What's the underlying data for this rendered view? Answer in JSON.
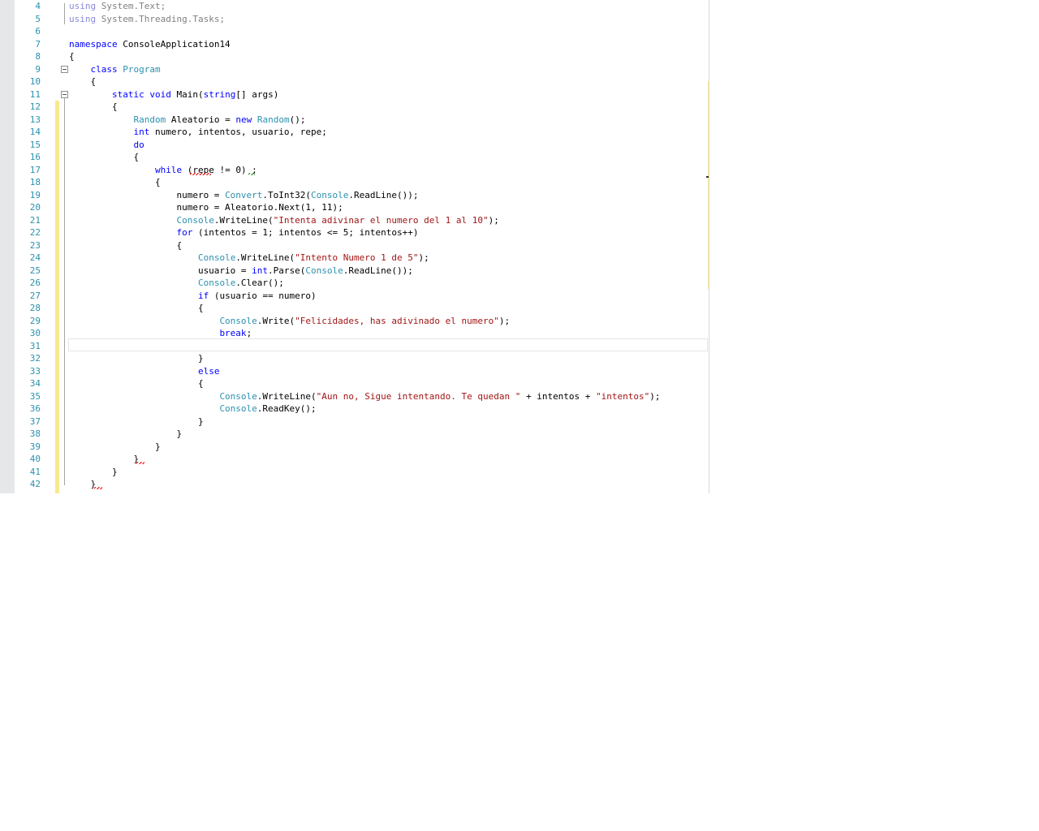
{
  "editor": {
    "lines": [
      {
        "n": "4",
        "segments": [
          {
            "t": "using",
            "c": "dim-kw"
          },
          {
            "t": " System.Text;",
            "c": "dim"
          }
        ]
      },
      {
        "n": "5",
        "segments": [
          {
            "t": "using",
            "c": "dim-kw"
          },
          {
            "t": " System.Threading.Tasks;",
            "c": "dim"
          }
        ]
      },
      {
        "n": "6",
        "segments": []
      },
      {
        "n": "7",
        "segments": [
          {
            "t": "namespace",
            "c": "kw"
          },
          {
            "t": " ConsoleApplication14",
            "c": ""
          }
        ]
      },
      {
        "n": "8",
        "segments": [
          {
            "t": "{",
            "c": ""
          }
        ]
      },
      {
        "n": "9",
        "segments": [
          {
            "t": "    ",
            "c": ""
          },
          {
            "t": "class",
            "c": "kw"
          },
          {
            "t": " ",
            "c": ""
          },
          {
            "t": "Program",
            "c": "ty"
          }
        ]
      },
      {
        "n": "10",
        "segments": [
          {
            "t": "    {",
            "c": ""
          }
        ]
      },
      {
        "n": "11",
        "segments": [
          {
            "t": "        ",
            "c": ""
          },
          {
            "t": "static",
            "c": "kw"
          },
          {
            "t": " ",
            "c": ""
          },
          {
            "t": "void",
            "c": "kw"
          },
          {
            "t": " Main(",
            "c": ""
          },
          {
            "t": "string",
            "c": "kw"
          },
          {
            "t": "[] args)",
            "c": ""
          }
        ]
      },
      {
        "n": "12",
        "segments": [
          {
            "t": "        {",
            "c": ""
          }
        ]
      },
      {
        "n": "13",
        "segments": [
          {
            "t": "            ",
            "c": ""
          },
          {
            "t": "Random",
            "c": "ty"
          },
          {
            "t": " Aleatorio = ",
            "c": ""
          },
          {
            "t": "new",
            "c": "kw"
          },
          {
            "t": " ",
            "c": ""
          },
          {
            "t": "Random",
            "c": "ty"
          },
          {
            "t": "();",
            "c": ""
          }
        ]
      },
      {
        "n": "14",
        "segments": [
          {
            "t": "            ",
            "c": ""
          },
          {
            "t": "int",
            "c": "kw"
          },
          {
            "t": " numero, intentos, usuario, repe;",
            "c": ""
          }
        ]
      },
      {
        "n": "15",
        "segments": [
          {
            "t": "            ",
            "c": ""
          },
          {
            "t": "do",
            "c": "kw"
          }
        ]
      },
      {
        "n": "16",
        "segments": [
          {
            "t": "            {",
            "c": ""
          }
        ]
      },
      {
        "n": "17",
        "segments": [
          {
            "t": "                ",
            "c": ""
          },
          {
            "t": "while",
            "c": "kw"
          },
          {
            "t": " (repe != 0) ;",
            "c": ""
          }
        ]
      },
      {
        "n": "18",
        "segments": [
          {
            "t": "                {",
            "c": ""
          }
        ]
      },
      {
        "n": "19",
        "segments": [
          {
            "t": "                    numero = ",
            "c": ""
          },
          {
            "t": "Convert",
            "c": "ty"
          },
          {
            "t": ".ToInt32(",
            "c": ""
          },
          {
            "t": "Console",
            "c": "ty"
          },
          {
            "t": ".ReadLine());",
            "c": ""
          }
        ]
      },
      {
        "n": "20",
        "segments": [
          {
            "t": "                    numero = Aleatorio.Next(1, 11);",
            "c": ""
          }
        ]
      },
      {
        "n": "21",
        "segments": [
          {
            "t": "                    ",
            "c": ""
          },
          {
            "t": "Console",
            "c": "ty"
          },
          {
            "t": ".WriteLine(",
            "c": ""
          },
          {
            "t": "\"Intenta adivinar el numero del 1 al 10\"",
            "c": "st"
          },
          {
            "t": ");",
            "c": ""
          }
        ]
      },
      {
        "n": "22",
        "segments": [
          {
            "t": "                    ",
            "c": ""
          },
          {
            "t": "for",
            "c": "kw"
          },
          {
            "t": " (intentos = 1; intentos <= 5; intentos++)",
            "c": ""
          }
        ]
      },
      {
        "n": "23",
        "segments": [
          {
            "t": "                    {",
            "c": ""
          }
        ]
      },
      {
        "n": "24",
        "segments": [
          {
            "t": "                        ",
            "c": ""
          },
          {
            "t": "Console",
            "c": "ty"
          },
          {
            "t": ".WriteLine(",
            "c": ""
          },
          {
            "t": "\"Intento Numero 1 de 5\"",
            "c": "st"
          },
          {
            "t": ");",
            "c": ""
          }
        ]
      },
      {
        "n": "25",
        "segments": [
          {
            "t": "                        usuario = ",
            "c": ""
          },
          {
            "t": "int",
            "c": "kw"
          },
          {
            "t": ".Parse(",
            "c": ""
          },
          {
            "t": "Console",
            "c": "ty"
          },
          {
            "t": ".ReadLine());",
            "c": ""
          }
        ]
      },
      {
        "n": "26",
        "segments": [
          {
            "t": "                        ",
            "c": ""
          },
          {
            "t": "Console",
            "c": "ty"
          },
          {
            "t": ".Clear();",
            "c": ""
          }
        ]
      },
      {
        "n": "27",
        "segments": [
          {
            "t": "                        ",
            "c": ""
          },
          {
            "t": "if",
            "c": "kw"
          },
          {
            "t": " (usuario == numero)",
            "c": ""
          }
        ]
      },
      {
        "n": "28",
        "segments": [
          {
            "t": "                        {",
            "c": ""
          }
        ]
      },
      {
        "n": "29",
        "segments": [
          {
            "t": "                            ",
            "c": ""
          },
          {
            "t": "Console",
            "c": "ty"
          },
          {
            "t": ".Write(",
            "c": ""
          },
          {
            "t": "\"Felicidades, has adivinado el numero\"",
            "c": "st"
          },
          {
            "t": ");",
            "c": ""
          }
        ]
      },
      {
        "n": "30",
        "segments": [
          {
            "t": "                            ",
            "c": ""
          },
          {
            "t": "break",
            "c": "kw"
          },
          {
            "t": ";",
            "c": ""
          }
        ]
      },
      {
        "n": "31",
        "segments": []
      },
      {
        "n": "32",
        "segments": [
          {
            "t": "                        }",
            "c": ""
          }
        ]
      },
      {
        "n": "33",
        "segments": [
          {
            "t": "                        ",
            "c": ""
          },
          {
            "t": "else",
            "c": "kw"
          }
        ]
      },
      {
        "n": "34",
        "segments": [
          {
            "t": "                        {",
            "c": ""
          }
        ]
      },
      {
        "n": "35",
        "segments": [
          {
            "t": "                            ",
            "c": ""
          },
          {
            "t": "Console",
            "c": "ty"
          },
          {
            "t": ".WriteLine(",
            "c": ""
          },
          {
            "t": "\"Aun no, Sigue intentando. Te quedan \"",
            "c": "st"
          },
          {
            "t": " + intentos + ",
            "c": ""
          },
          {
            "t": "\"intentos\"",
            "c": "st"
          },
          {
            "t": ");",
            "c": ""
          }
        ]
      },
      {
        "n": "36",
        "segments": [
          {
            "t": "                            ",
            "c": ""
          },
          {
            "t": "Console",
            "c": "ty"
          },
          {
            "t": ".ReadKey();",
            "c": ""
          }
        ]
      },
      {
        "n": "37",
        "segments": [
          {
            "t": "                        }",
            "c": ""
          }
        ]
      },
      {
        "n": "38",
        "segments": [
          {
            "t": "                    }",
            "c": ""
          }
        ]
      },
      {
        "n": "39",
        "segments": [
          {
            "t": "                }",
            "c": ""
          }
        ]
      },
      {
        "n": "40",
        "segments": [
          {
            "t": "            }",
            "c": ""
          }
        ]
      },
      {
        "n": "41",
        "segments": [
          {
            "t": "        }",
            "c": ""
          }
        ]
      },
      {
        "n": "42",
        "segments": [
          {
            "t": "    }",
            "c": ""
          }
        ]
      }
    ]
  },
  "colors": {
    "keyword": "#0000ff",
    "type": "#2b91af",
    "string": "#a31515",
    "line_number": "#2b91af",
    "change_bar": "#f7e98e"
  }
}
